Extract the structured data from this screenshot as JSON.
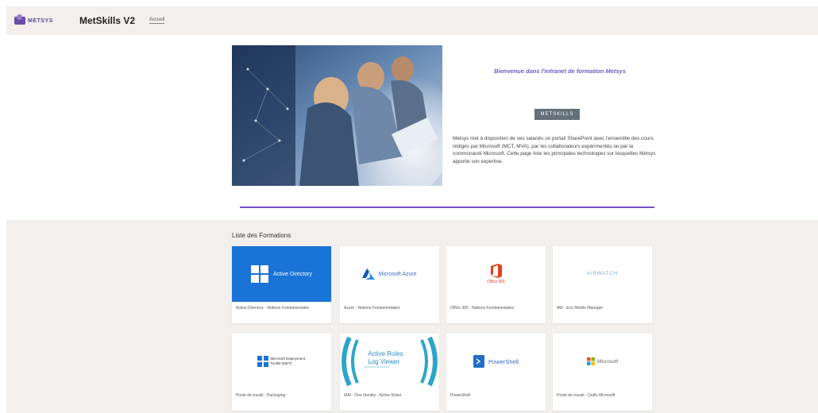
{
  "header": {
    "logo_text": "METSYS",
    "site_title": "MetSkills V2",
    "nav_link": "Accueil"
  },
  "hero": {
    "welcome": "Bienvenue dans l'intranet de formation Metsys",
    "tag": "METSKILLS",
    "description": "Metsys met à disposition de ses salariés un portail SharePoint avec l'ensemble des cours rédigés par Microsoft (MCT, MVA), par les collaborateurs expérimentés ou par la communauté Microsoft. Cette page liste les principales technologies sur lesquelles Metsys apporte son expertise."
  },
  "formations": {
    "title": "Liste des Formations",
    "cards": [
      {
        "logo": "Active Directory",
        "caption": "Active Directory - Notions Fondamentales"
      },
      {
        "logo": "Microsoft Azure",
        "caption": "Azure - Notions Fondamentales"
      },
      {
        "logo": "Office 365",
        "caption": "Office 365 - Notions Fondamentales"
      },
      {
        "logo": "AIRWATCH",
        "caption": "AW - Eco Mobile Manager"
      },
      {
        "logo": "Microsoft Deployment Toolkit (MDT)",
        "caption": "Poste de travail - Packaging"
      },
      {
        "logo_line1": "Active Roles",
        "logo_line2": "Log Viewer",
        "caption": "IAM - One Identity - Active Roles"
      },
      {
        "logo": "PowerShell",
        "caption": "PowerShell"
      },
      {
        "logo": "Microsoft",
        "caption": "Poste de travail - Outils Microsoft"
      }
    ]
  },
  "colors": {
    "header_bg": "#f2efed",
    "accent_purple": "#7b4fc9",
    "tag_bg": "#64707a",
    "ad_blue": "#1a73d6"
  }
}
